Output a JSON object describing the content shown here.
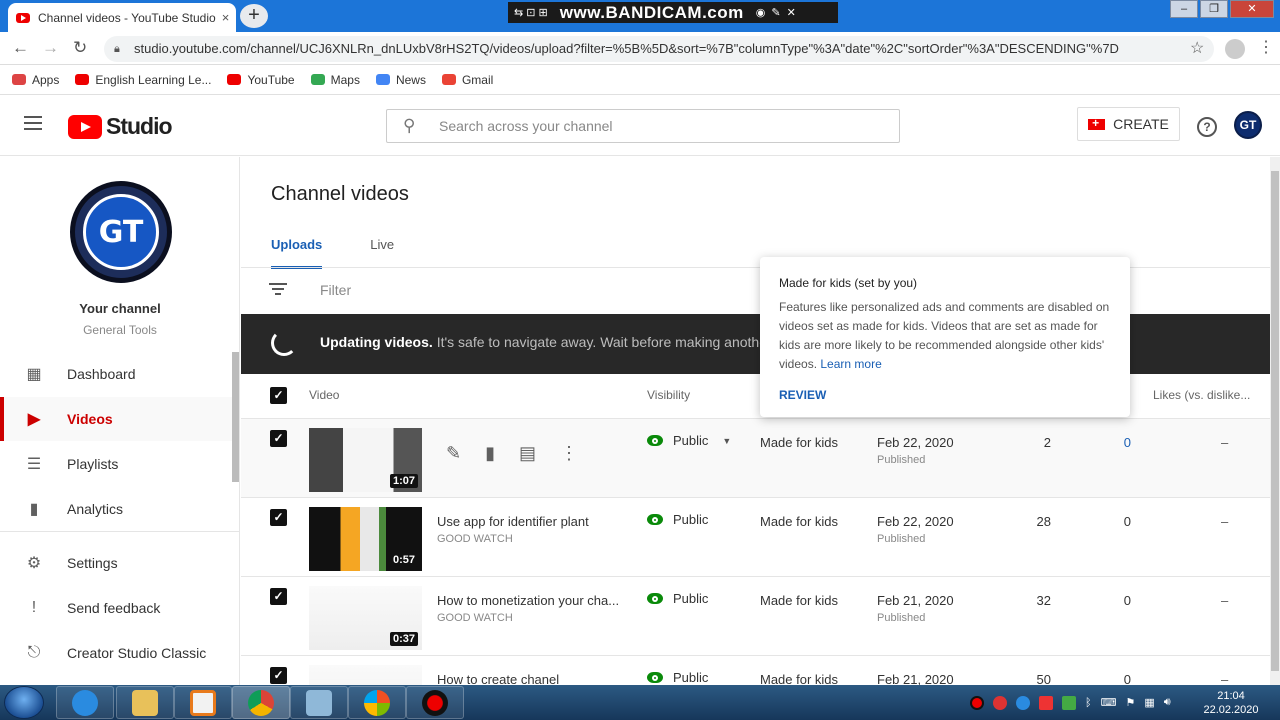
{
  "browser": {
    "tab_title": "Channel videos - YouTube Studio",
    "tab_close": "×",
    "new_tab": "+",
    "url": "studio.youtube.com/channel/UCJ6XNLRn_dnLUxbV8rHS2TQ/videos/upload?filter=%5B%5D&sort=%7B\"columnType\"%3A\"date\"%2C\"sortOrder\"%3A\"DESCENDING\"%7D",
    "bookmarks": [
      {
        "label": "Apps",
        "color": "#d44"
      },
      {
        "label": "English Learning Le...",
        "color": "#e00"
      },
      {
        "label": "YouTube",
        "color": "#e00"
      },
      {
        "label": "Maps",
        "color": "#34a853"
      },
      {
        "label": "News",
        "color": "#4285f4"
      },
      {
        "label": "Gmail",
        "color": "#ea4335"
      }
    ],
    "recorder_watermark": "www.BANDICAM.com"
  },
  "header": {
    "logo_text": "Studio",
    "search_placeholder": "Search across your channel",
    "create_label": "CREATE",
    "help_symbol": "?",
    "avatar_initials": "GT"
  },
  "sidebar": {
    "channel_logo_text": "GT",
    "channel_title": "Your channel",
    "channel_name": "General Tools",
    "items": [
      {
        "label": "Dashboard",
        "icon": "dashboard-icon",
        "glyph": "▦"
      },
      {
        "label": "Videos",
        "icon": "videos-icon",
        "glyph": "▶"
      },
      {
        "label": "Playlists",
        "icon": "playlists-icon",
        "glyph": "☰"
      },
      {
        "label": "Analytics",
        "icon": "analytics-icon",
        "glyph": "▮"
      },
      {
        "label": "Settings",
        "icon": "gear-icon",
        "glyph": "⚙"
      },
      {
        "label": "Send feedback",
        "icon": "feedback-icon",
        "glyph": "!"
      },
      {
        "label": "Creator Studio Classic",
        "icon": "classic-icon",
        "glyph": "⎋"
      }
    ]
  },
  "main": {
    "title": "Channel videos",
    "tabs": [
      {
        "label": "Uploads"
      },
      {
        "label": "Live"
      }
    ],
    "filter_placeholder": "Filter",
    "banner": {
      "bold": "Updating videos.",
      "rest": "It's safe to navigate away. Wait before making anothe"
    },
    "columns": {
      "video": "Video",
      "visibility": "Visibility",
      "likes": "Likes (vs. dislike..."
    },
    "rows": [
      {
        "title": "",
        "description": "",
        "duration": "1:07",
        "visibility": "Public",
        "audience": "Made for kids",
        "date": "Feb 22, 2020",
        "status": "Published",
        "views": "2",
        "comments": "0",
        "likes": "–"
      },
      {
        "title": "Use app for identifier plant",
        "description": "GOOD WATCH",
        "duration": "0:57",
        "visibility": "Public",
        "audience": "Made for kids",
        "date": "Feb 22, 2020",
        "status": "Published",
        "views": "28",
        "comments": "0",
        "likes": "–"
      },
      {
        "title": "How to monetization your cha...",
        "description": "GOOD WATCH",
        "duration": "0:37",
        "visibility": "Public",
        "audience": "Made for kids",
        "date": "Feb 21, 2020",
        "status": "Published",
        "views": "32",
        "comments": "0",
        "likes": "–"
      },
      {
        "title": "How to create chanel",
        "description": "",
        "duration": "",
        "visibility": "Public",
        "audience": "Made for kids",
        "date": "Feb 21, 2020",
        "status": "",
        "views": "50",
        "comments": "0",
        "likes": "–"
      }
    ]
  },
  "tooltip": {
    "heading": "Made for kids (set by you)",
    "body": "Features like personalized ads and comments are disabled on videos set as made for kids. Videos that are set as made for kids are more likely to be recommended alongside other kids' videos.",
    "link": "Learn more",
    "action": "REVIEW"
  },
  "taskbar": {
    "time": "21:04",
    "date": "22.02.2020"
  }
}
